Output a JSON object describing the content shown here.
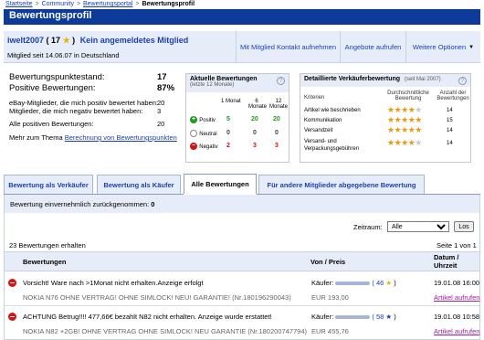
{
  "breadcrumb": {
    "items": [
      "Startseite",
      "Community",
      "Bewertungsportal"
    ],
    "current": "Bewertungsprofil",
    "separator": ">"
  },
  "title": "Bewertungsprofil",
  "member": {
    "name": "iwelt2007",
    "score_open": "( 17",
    "score_close": ")",
    "status": "Kein angemeldetes Mitglied",
    "since": "Mitglied seit 14.06.07 in Deutschland"
  },
  "actions": {
    "contact": "Mit Mitglied Kontakt aufnehmen",
    "offers": "Angebote aufrufen",
    "more": "Weitere Optionen"
  },
  "summary": {
    "points_label": "Bewertungspunktestand:",
    "points_value": "17",
    "positive_label": "Positive Bewertungen:",
    "positive_value": "87%",
    "pos_members_label": "eBay-Mitglieder, die mich positiv bewertet haben:",
    "pos_members_value": "20",
    "neg_members_label": "Mitglieder, die mich negativ bewertet haben:",
    "neg_members_value": "3",
    "all_pos_label": "Alle positiven Bewertungen:",
    "all_pos_value": "20",
    "more_prefix": "Mehr zum Thema",
    "more_link": "Berechnung von Bewertungspunkten"
  },
  "recent": {
    "title": "Aktuelle Bewertungen",
    "subtitle": "(letzte 12 Monate)",
    "help": "?",
    "col1": "1 Monat",
    "col2_line1": "6",
    "col2_line2": "Monate",
    "col3_line1": "12",
    "col3_line2": "Monate",
    "rows": [
      {
        "label": "Positiv",
        "v1": "5",
        "v2": "20",
        "v3": "20",
        "color": "#1c9a1c",
        "sign": "+"
      },
      {
        "label": "Neutral",
        "v1": "0",
        "v2": "0",
        "v3": "0",
        "color": "#8c8c8c",
        "sign": "○"
      },
      {
        "label": "Negativ",
        "v1": "2",
        "v2": "3",
        "v3": "3",
        "color": "#d41414",
        "sign": "−"
      }
    ]
  },
  "detailed": {
    "title": "Detaillierte Verkäuferbewertung",
    "subtitle": "(seit Mai 2007)",
    "help": "?",
    "col_criteria": "Kriterien",
    "col_avg_line1": "Durchschnittliche",
    "col_avg_line2": "Bewertung",
    "col_count_line1": "Anzahl der",
    "col_count_line2": "Bewertungen",
    "rows": [
      {
        "label": "Artikel wie beschrieben",
        "stars": 4,
        "count": "14"
      },
      {
        "label": "Kommunikation",
        "stars": 4.5,
        "count": "15"
      },
      {
        "label": "Versandzeit",
        "stars": 4.5,
        "count": "14"
      },
      {
        "label_line1": "Versand- und",
        "label_line2": "Verpackungsgebühren",
        "stars": 4,
        "count": "14"
      }
    ]
  },
  "tabs": [
    {
      "label": "Bewertung als Verkäufer",
      "active": false
    },
    {
      "label": "Bewertung als Käufer",
      "active": false
    },
    {
      "label": "Alle Bewertungen",
      "active": true
    },
    {
      "label": "Für andere Mitglieder abgegebene Bewertung",
      "active": false
    }
  ],
  "withdrawn": {
    "label": "Bewertung einvernehmlich zurückgenommen:",
    "value": "0"
  },
  "filter": {
    "label": "Zeitraum:",
    "selected": "Alle",
    "button": "Los"
  },
  "list": {
    "count_text": "23 Bewertungen erhalten",
    "page_text": "Seite 1 von 1",
    "col_reviews": "Bewertungen",
    "col_from": "Von / Preis",
    "col_date_line1": "Datum /",
    "col_date_line2": "Uhrzeit",
    "rows": [
      {
        "comment": "Vorsicht! Ware nach >1Monat nicht erhalten.Anzeige erfolgt",
        "item": "NOKIA N76 OHNE VERTRAG! OHNE SIMLOCK! NEU! GARANTIE! (Nr.180196290043)",
        "buyer_label": "Käufer:",
        "buyer_score": "( 46",
        "star": "yellow",
        "price": "EUR 193,00",
        "date": "19.01.08 16:00",
        "action": "Artikel aufrufen"
      },
      {
        "comment": "ACHTUNG Betrug!!!! 477,66€ bezahlt N82 nicht erhalten. Anzeige wurde erstattet!",
        "item": "NOKIA N82 +2GB! OHNE VERTRAG OHNE SIMLOCK! NEU GARANTIE (Nr.180200747794)",
        "buyer_label": "Käufer:",
        "buyer_score": "( 58",
        "star": "blue",
        "price": "EUR 455,76",
        "date": "19.01.08 10:58",
        "action": "Artikel aufrufen"
      }
    ]
  }
}
